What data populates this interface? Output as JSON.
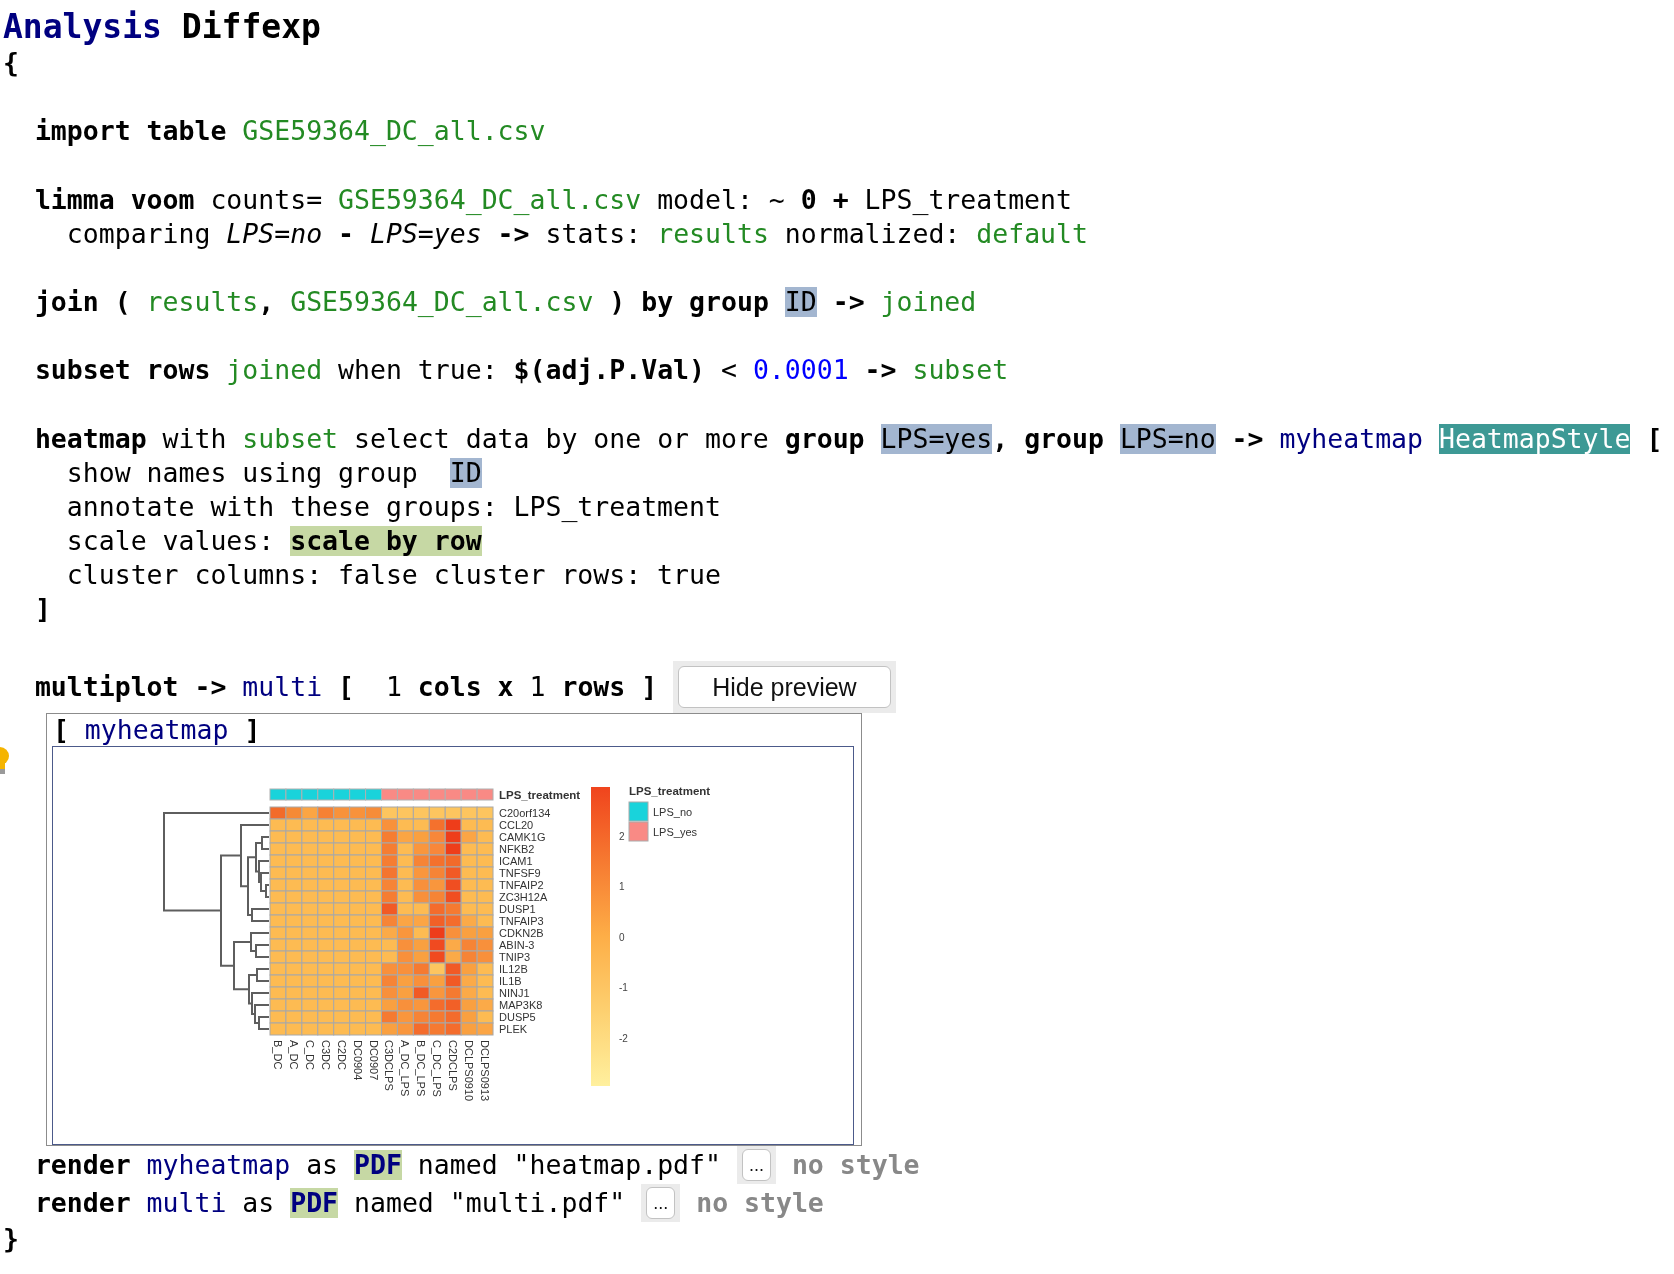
{
  "document": {
    "title": {
      "tokens": [
        {
          "kind": "concept",
          "text": "Analysis"
        },
        {
          "kind": "kw",
          "text": "Diffexp"
        }
      ]
    },
    "open": {
      "tokens": [
        {
          "kind": "kw",
          "text": "{"
        }
      ]
    },
    "statements": [
      {
        "lines": [
          {
            "kind": "code",
            "tokens": [
              {
                "kind": "kw",
                "text": "import table"
              },
              {
                "kind": "ref",
                "text": "GSE59364_DC_all.csv"
              }
            ]
          }
        ]
      },
      {
        "lines": [
          {
            "kind": "code",
            "tokens": [
              {
                "kind": "kw",
                "text": "limma voom"
              },
              {
                "kind": "txt",
                "text": "counts="
              },
              {
                "kind": "ref",
                "text": "GSE59364_DC_all.csv"
              },
              {
                "kind": "txt",
                "text": "model: ~"
              },
              {
                "kind": "kw",
                "text": "0 +"
              },
              {
                "kind": "txt",
                "text": "LPS_treatment"
              }
            ],
            "children": [
              {
                "kind": "code",
                "tokens": [
                  {
                    "kind": "txt",
                    "text": "comparing"
                  },
                  {
                    "kind": "it",
                    "text": "LPS=no"
                  },
                  {
                    "kind": "kw",
                    "text": "-"
                  },
                  {
                    "kind": "it",
                    "text": "LPS=yes"
                  },
                  {
                    "kind": "kw",
                    "text": "->"
                  },
                  {
                    "kind": "txt",
                    "text": "stats:"
                  },
                  {
                    "kind": "ref",
                    "text": "results"
                  },
                  {
                    "kind": "txt",
                    "text": "normalized:"
                  },
                  {
                    "kind": "ref",
                    "text": "default"
                  }
                ]
              }
            ]
          }
        ]
      },
      {
        "lines": [
          {
            "kind": "code",
            "tokens": [
              {
                "kind": "kw",
                "text": "join ("
              },
              {
                "kind": "ref",
                "text": "results"
              },
              {
                "kind": "punct",
                "text": ","
              },
              {
                "kind": "ref",
                "text": "GSE59364_DC_all.csv"
              },
              {
                "kind": "kw",
                "text": ") by group"
              },
              {
                "kind": "chip",
                "text": "ID"
              },
              {
                "kind": "kw",
                "text": "->"
              },
              {
                "kind": "ref",
                "text": "joined"
              }
            ]
          }
        ]
      },
      {
        "lines": [
          {
            "kind": "code",
            "tokens": [
              {
                "kind": "kw",
                "text": "subset rows"
              },
              {
                "kind": "ref",
                "text": "joined"
              },
              {
                "kind": "txt",
                "text": "when true:"
              },
              {
                "kind": "kw",
                "text": "$(adj.P.Val)"
              },
              {
                "kind": "txt",
                "text": "<"
              },
              {
                "kind": "num",
                "text": "0.0001"
              },
              {
                "kind": "kw",
                "text": "->"
              },
              {
                "kind": "ref",
                "text": "subset"
              }
            ]
          }
        ]
      },
      {
        "lines": [
          {
            "kind": "code",
            "tokens": [
              {
                "kind": "kw",
                "text": "heatmap"
              },
              {
                "kind": "txt",
                "text": "with"
              },
              {
                "kind": "ref",
                "text": "subset"
              },
              {
                "kind": "txt",
                "text": "select data by one or more"
              },
              {
                "kind": "kw",
                "text": "group"
              },
              {
                "kind": "chip",
                "text": "LPS=yes"
              },
              {
                "kind": "punct",
                "text": ","
              },
              {
                "kind": "kw",
                "text": "group"
              },
              {
                "kind": "chip",
                "text": "LPS=no"
              },
              {
                "kind": "kw",
                "text": "->"
              },
              {
                "kind": "id",
                "text": "myheatmap"
              },
              {
                "kind": "style",
                "text": "HeatmapStyle"
              },
              {
                "kind": "kw",
                "text": "["
              }
            ],
            "children": [
              {
                "kind": "code",
                "tokens": [
                  {
                    "kind": "txt",
                    "text": "show names using group"
                  },
                  {
                    "kind": "slotchip",
                    "text": "ID"
                  }
                ]
              },
              {
                "kind": "code",
                "tokens": [
                  {
                    "kind": "txt",
                    "text": "annotate with these groups: LPS_treatment"
                  }
                ]
              },
              {
                "kind": "code",
                "tokens": [
                  {
                    "kind": "txt",
                    "text": "scale values:"
                  },
                  {
                    "kind": "option",
                    "text": "scale by row"
                  }
                ]
              },
              {
                "kind": "code",
                "tokens": [
                  {
                    "kind": "txt",
                    "text": "cluster columns: false cluster rows: true"
                  }
                ]
              }
            ]
          },
          {
            "kind": "code",
            "tokens": [
              {
                "kind": "kw",
                "text": "]"
              }
            ]
          }
        ]
      },
      {
        "lines": [
          {
            "kind": "code",
            "tokens": [
              {
                "kind": "kw",
                "text": "multiplot ->"
              },
              {
                "kind": "id",
                "text": "multi"
              },
              {
                "kind": "kw",
                "text": "["
              },
              {
                "kind": "value",
                "text": "1"
              },
              {
                "kind": "kw",
                "text": "cols x"
              },
              {
                "kind": "txt",
                "text": "1"
              },
              {
                "kind": "kw",
                "text": "rows ]"
              },
              {
                "kind": "toggle",
                "text": "Hide preview"
              }
            ]
          },
          {
            "kind": "preview",
            "label": [
              {
                "kind": "kw",
                "text": "["
              },
              {
                "kind": "id",
                "text": "myheatmap"
              },
              {
                "kind": "kw",
                "text": "]"
              }
            ],
            "heatmap": {
              "annotation_label": "LPS_treatment",
              "columns": [
                {
                  "label": "B_DC",
                  "color": "#19d3db"
                },
                {
                  "label": "A_DC",
                  "color": "#19d3db"
                },
                {
                  "label": "C_DC",
                  "color": "#19d3db"
                },
                {
                  "label": "C3DC",
                  "color": "#19d3db"
                },
                {
                  "label": "C2DC",
                  "color": "#19d3db"
                },
                {
                  "label": "DC0904",
                  "color": "#19d3db"
                },
                {
                  "label": "DC0907",
                  "color": "#19d3db"
                },
                {
                  "label": "C3DCLPS",
                  "color": "#f98a85"
                },
                {
                  "label": "A_DC_LPS",
                  "color": "#f98a85"
                },
                {
                  "label": "B_DC_LPS",
                  "color": "#f98a85"
                },
                {
                  "label": "C_DC_LPS",
                  "color": "#f98a85"
                },
                {
                  "label": "C2DCLPS",
                  "color": "#f98a85"
                },
                {
                  "label": "DCLPS0910",
                  "color": "#f98a85"
                },
                {
                  "label": "DCLPS0913",
                  "color": "#f98a85"
                }
              ],
              "rows": [
                {
                  "label": "C20orf134",
                  "cells": [
                    {
                      "color": "#f26b2a"
                    },
                    {
                      "color": "#f58a36"
                    },
                    {
                      "color": "#fba544"
                    },
                    {
                      "color": "#f68134"
                    },
                    {
                      "color": "#f8923b"
                    },
                    {
                      "color": "#f8923b"
                    },
                    {
                      "color": "#f68c38"
                    },
                    {
                      "color": "#fdc55f"
                    },
                    {
                      "color": "#fdc55f"
                    },
                    {
                      "color": "#fdc55f"
                    },
                    {
                      "color": "#fdc55f"
                    },
                    {
                      "color": "#fdc55f"
                    },
                    {
                      "color": "#fdc55f"
                    },
                    {
                      "color": "#fdc55f"
                    }
                  ]
                },
                {
                  "label": "CCL20",
                  "cells": [
                    {
                      "color": "#fdbb52"
                    },
                    {
                      "color": "#fdbb52"
                    },
                    {
                      "color": "#fdbb52"
                    },
                    {
                      "color": "#fdbb52"
                    },
                    {
                      "color": "#fdbb52"
                    },
                    {
                      "color": "#fdbb52"
                    },
                    {
                      "color": "#fdbb52"
                    },
                    {
                      "color": "#f8913b"
                    },
                    {
                      "color": "#fdbb52"
                    },
                    {
                      "color": "#fdbb52"
                    },
                    {
                      "color": "#f4712d"
                    },
                    {
                      "color": "#ee3d1a"
                    },
                    {
                      "color": "#fdbb52"
                    },
                    {
                      "color": "#fdbb52"
                    }
                  ]
                },
                {
                  "label": "CAMK1G",
                  "cells": [
                    {
                      "color": "#fdbb52"
                    },
                    {
                      "color": "#fdbb52"
                    },
                    {
                      "color": "#fdbb52"
                    },
                    {
                      "color": "#fdbb52"
                    },
                    {
                      "color": "#fdbb52"
                    },
                    {
                      "color": "#fdbb52"
                    },
                    {
                      "color": "#fdbb52"
                    },
                    {
                      "color": "#f57d32"
                    },
                    {
                      "color": "#fba544"
                    },
                    {
                      "color": "#f9a040"
                    },
                    {
                      "color": "#f8873a"
                    },
                    {
                      "color": "#ee3d1a"
                    },
                    {
                      "color": "#fba545"
                    },
                    {
                      "color": "#fdbb52"
                    }
                  ]
                },
                {
                  "label": "NFKB2",
                  "cells": [
                    {
                      "color": "#fdbb52"
                    },
                    {
                      "color": "#fdbb52"
                    },
                    {
                      "color": "#fdbb52"
                    },
                    {
                      "color": "#fdbb52"
                    },
                    {
                      "color": "#fdbb52"
                    },
                    {
                      "color": "#fdbb52"
                    },
                    {
                      "color": "#fdbb52"
                    },
                    {
                      "color": "#f57d32"
                    },
                    {
                      "color": "#fdbb52"
                    },
                    {
                      "color": "#f9963d"
                    },
                    {
                      "color": "#f8873a"
                    },
                    {
                      "color": "#ee3d1a"
                    },
                    {
                      "color": "#fdbb52"
                    },
                    {
                      "color": "#fdbb52"
                    }
                  ]
                },
                {
                  "label": "ICAM1",
                  "cells": [
                    {
                      "color": "#fdbb52"
                    },
                    {
                      "color": "#fdbb52"
                    },
                    {
                      "color": "#fdbb52"
                    },
                    {
                      "color": "#fdbb52"
                    },
                    {
                      "color": "#fdbb52"
                    },
                    {
                      "color": "#fdbb52"
                    },
                    {
                      "color": "#fdbb52"
                    },
                    {
                      "color": "#f57d32"
                    },
                    {
                      "color": "#fdbb52"
                    },
                    {
                      "color": "#f68436"
                    },
                    {
                      "color": "#f4712d"
                    },
                    {
                      "color": "#f26a2a"
                    },
                    {
                      "color": "#fdbb52"
                    },
                    {
                      "color": "#fdbb52"
                    }
                  ]
                },
                {
                  "label": "TNFSF9",
                  "cells": [
                    {
                      "color": "#fdbb52"
                    },
                    {
                      "color": "#fdbb52"
                    },
                    {
                      "color": "#fdbb52"
                    },
                    {
                      "color": "#fdbb52"
                    },
                    {
                      "color": "#fdbb52"
                    },
                    {
                      "color": "#fdbb52"
                    },
                    {
                      "color": "#fdbb52"
                    },
                    {
                      "color": "#f47530"
                    },
                    {
                      "color": "#fdbb52"
                    },
                    {
                      "color": "#f9963d"
                    },
                    {
                      "color": "#f68436"
                    },
                    {
                      "color": "#f15a25"
                    },
                    {
                      "color": "#fdbb52"
                    },
                    {
                      "color": "#fdbb52"
                    }
                  ]
                },
                {
                  "label": "TNFAIP2",
                  "cells": [
                    {
                      "color": "#fdbb52"
                    },
                    {
                      "color": "#fdbb52"
                    },
                    {
                      "color": "#fdbb52"
                    },
                    {
                      "color": "#fdbb52"
                    },
                    {
                      "color": "#fdbb52"
                    },
                    {
                      "color": "#fdbb52"
                    },
                    {
                      "color": "#fdbb52"
                    },
                    {
                      "color": "#f68436"
                    },
                    {
                      "color": "#fdbb52"
                    },
                    {
                      "color": "#f8903b"
                    },
                    {
                      "color": "#f9963d"
                    },
                    {
                      "color": "#f04e21"
                    },
                    {
                      "color": "#fdbb52"
                    },
                    {
                      "color": "#fdbb52"
                    }
                  ]
                },
                {
                  "label": "ZC3H12A",
                  "cells": [
                    {
                      "color": "#fdbb52"
                    },
                    {
                      "color": "#fdbb52"
                    },
                    {
                      "color": "#fdbb52"
                    },
                    {
                      "color": "#fdbb52"
                    },
                    {
                      "color": "#fdbb52"
                    },
                    {
                      "color": "#fdbb52"
                    },
                    {
                      "color": "#fdbb52"
                    },
                    {
                      "color": "#f57d32"
                    },
                    {
                      "color": "#fdbb52"
                    },
                    {
                      "color": "#f8903b"
                    },
                    {
                      "color": "#f68436"
                    },
                    {
                      "color": "#f04e21"
                    },
                    {
                      "color": "#fdbb52"
                    },
                    {
                      "color": "#fdbb52"
                    }
                  ]
                },
                {
                  "label": "DUSP1",
                  "cells": [
                    {
                      "color": "#fdbb52"
                    },
                    {
                      "color": "#fdbb52"
                    },
                    {
                      "color": "#fdbb52"
                    },
                    {
                      "color": "#fdbb52"
                    },
                    {
                      "color": "#fdbb52"
                    },
                    {
                      "color": "#fdbb52"
                    },
                    {
                      "color": "#fdbb52"
                    },
                    {
                      "color": "#f15a25"
                    },
                    {
                      "color": "#fdbb52"
                    },
                    {
                      "color": "#fdbb52"
                    },
                    {
                      "color": "#f46c2c"
                    },
                    {
                      "color": "#f57a31"
                    },
                    {
                      "color": "#fdbb52"
                    },
                    {
                      "color": "#fdbb52"
                    }
                  ]
                },
                {
                  "label": "TNFAIP3",
                  "cells": [
                    {
                      "color": "#fdbb52"
                    },
                    {
                      "color": "#fdbb52"
                    },
                    {
                      "color": "#fdbb52"
                    },
                    {
                      "color": "#fdbb52"
                    },
                    {
                      "color": "#fdbb52"
                    },
                    {
                      "color": "#fdbb52"
                    },
                    {
                      "color": "#fdbb52"
                    },
                    {
                      "color": "#f68436"
                    },
                    {
                      "color": "#fba545"
                    },
                    {
                      "color": "#fba545"
                    },
                    {
                      "color": "#f26027"
                    },
                    {
                      "color": "#f46c2c"
                    },
                    {
                      "color": "#fbaa48"
                    },
                    {
                      "color": "#fdbb52"
                    }
                  ]
                },
                {
                  "label": "CDKN2B",
                  "cells": [
                    {
                      "color": "#fdbb52"
                    },
                    {
                      "color": "#fdbb52"
                    },
                    {
                      "color": "#fdbb52"
                    },
                    {
                      "color": "#fdbb52"
                    },
                    {
                      "color": "#fdbb52"
                    },
                    {
                      "color": "#fdbb52"
                    },
                    {
                      "color": "#fdbb52"
                    },
                    {
                      "color": "#fbaa48"
                    },
                    {
                      "color": "#f9963d"
                    },
                    {
                      "color": "#fdbb52"
                    },
                    {
                      "color": "#ee3d1a"
                    },
                    {
                      "color": "#f8903b"
                    },
                    {
                      "color": "#f9a040"
                    },
                    {
                      "color": "#f9a040"
                    }
                  ]
                },
                {
                  "label": "ABIN-3",
                  "cells": [
                    {
                      "color": "#fdbb52"
                    },
                    {
                      "color": "#fdbb52"
                    },
                    {
                      "color": "#fdbb52"
                    },
                    {
                      "color": "#fdbb52"
                    },
                    {
                      "color": "#fdbb52"
                    },
                    {
                      "color": "#fdbb52"
                    },
                    {
                      "color": "#fdbb52"
                    },
                    {
                      "color": "#fdbb52"
                    },
                    {
                      "color": "#f8903b"
                    },
                    {
                      "color": "#f9a040"
                    },
                    {
                      "color": "#f04a20"
                    },
                    {
                      "color": "#fbaa48"
                    },
                    {
                      "color": "#f68436"
                    },
                    {
                      "color": "#f8903b"
                    }
                  ]
                },
                {
                  "label": "TNIP3",
                  "cells": [
                    {
                      "color": "#fdbb52"
                    },
                    {
                      "color": "#fdbb52"
                    },
                    {
                      "color": "#fdbb52"
                    },
                    {
                      "color": "#fdbb52"
                    },
                    {
                      "color": "#fdbb52"
                    },
                    {
                      "color": "#fdbb52"
                    },
                    {
                      "color": "#fdbb52"
                    },
                    {
                      "color": "#fdbb52"
                    },
                    {
                      "color": "#f8903b"
                    },
                    {
                      "color": "#f9a040"
                    },
                    {
                      "color": "#f04a20"
                    },
                    {
                      "color": "#fbaa48"
                    },
                    {
                      "color": "#f68436"
                    },
                    {
                      "color": "#f8903b"
                    }
                  ]
                },
                {
                  "label": "IL12B",
                  "cells": [
                    {
                      "color": "#fdbb52"
                    },
                    {
                      "color": "#fdbb52"
                    },
                    {
                      "color": "#fdbb52"
                    },
                    {
                      "color": "#fdbb52"
                    },
                    {
                      "color": "#fdbb52"
                    },
                    {
                      "color": "#fdbb52"
                    },
                    {
                      "color": "#fdbb52"
                    },
                    {
                      "color": "#f8903b"
                    },
                    {
                      "color": "#f8903b"
                    },
                    {
                      "color": "#f57a31"
                    },
                    {
                      "color": "#fdc55f"
                    },
                    {
                      "color": "#f15a25"
                    },
                    {
                      "color": "#f9a040"
                    },
                    {
                      "color": "#fdbb52"
                    }
                  ]
                },
                {
                  "label": "IL1B",
                  "cells": [
                    {
                      "color": "#fdbb52"
                    },
                    {
                      "color": "#fdbb52"
                    },
                    {
                      "color": "#fdbb52"
                    },
                    {
                      "color": "#fdbb52"
                    },
                    {
                      "color": "#fdbb52"
                    },
                    {
                      "color": "#fdbb52"
                    },
                    {
                      "color": "#fdbb52"
                    },
                    {
                      "color": "#f68436"
                    },
                    {
                      "color": "#f9a040"
                    },
                    {
                      "color": "#f8903b"
                    },
                    {
                      "color": "#f9a040"
                    },
                    {
                      "color": "#f15a25"
                    },
                    {
                      "color": "#fbaa48"
                    },
                    {
                      "color": "#fdbb52"
                    }
                  ]
                },
                {
                  "label": "NINJ1",
                  "cells": [
                    {
                      "color": "#fdbb52"
                    },
                    {
                      "color": "#fdbb52"
                    },
                    {
                      "color": "#fdbb52"
                    },
                    {
                      "color": "#fdbb52"
                    },
                    {
                      "color": "#fdbb52"
                    },
                    {
                      "color": "#fdbb52"
                    },
                    {
                      "color": "#fdbb52"
                    },
                    {
                      "color": "#f8903b"
                    },
                    {
                      "color": "#f9a040"
                    },
                    {
                      "color": "#f15a25"
                    },
                    {
                      "color": "#f9963d"
                    },
                    {
                      "color": "#f57a31"
                    },
                    {
                      "color": "#fbaa48"
                    },
                    {
                      "color": "#fdbb52"
                    }
                  ]
                },
                {
                  "label": "MAP3K8",
                  "cells": [
                    {
                      "color": "#fdbb52"
                    },
                    {
                      "color": "#fdbb52"
                    },
                    {
                      "color": "#fdbb52"
                    },
                    {
                      "color": "#fdbb52"
                    },
                    {
                      "color": "#fdbb52"
                    },
                    {
                      "color": "#fdbb52"
                    },
                    {
                      "color": "#fdbb52"
                    },
                    {
                      "color": "#f9a040"
                    },
                    {
                      "color": "#f8903b"
                    },
                    {
                      "color": "#f9963d"
                    },
                    {
                      "color": "#f46c2c"
                    },
                    {
                      "color": "#f26027"
                    },
                    {
                      "color": "#f9a040"
                    },
                    {
                      "color": "#fbaa48"
                    }
                  ]
                },
                {
                  "label": "DUSP5",
                  "cells": [
                    {
                      "color": "#fdbb52"
                    },
                    {
                      "color": "#fdbb52"
                    },
                    {
                      "color": "#fdbb52"
                    },
                    {
                      "color": "#fdbb52"
                    },
                    {
                      "color": "#fdbb52"
                    },
                    {
                      "color": "#fdbb52"
                    },
                    {
                      "color": "#fdbb52"
                    },
                    {
                      "color": "#f57a31"
                    },
                    {
                      "color": "#f9963d"
                    },
                    {
                      "color": "#f68436"
                    },
                    {
                      "color": "#f57a31"
                    },
                    {
                      "color": "#f46c2c"
                    },
                    {
                      "color": "#f9a040"
                    },
                    {
                      "color": "#fdbb52"
                    }
                  ]
                },
                {
                  "label": "PLEK",
                  "cells": [
                    {
                      "color": "#fdbb52"
                    },
                    {
                      "color": "#fdbb52"
                    },
                    {
                      "color": "#fdbb52"
                    },
                    {
                      "color": "#fdbb52"
                    },
                    {
                      "color": "#fdbb52"
                    },
                    {
                      "color": "#fdbb52"
                    },
                    {
                      "color": "#fdbb52"
                    },
                    {
                      "color": "#f9a040"
                    },
                    {
                      "color": "#f9963d"
                    },
                    {
                      "color": "#f46c2c"
                    },
                    {
                      "color": "#f57a31"
                    },
                    {
                      "color": "#f46c2c"
                    },
                    {
                      "color": "#f9a040"
                    },
                    {
                      "color": "#fba545"
                    }
                  ]
                }
              ],
              "scale_ticks": [
                "2",
                "1",
                "0",
                "-1",
                "-2"
              ],
              "legend": {
                "title": "LPS_treatment",
                "items": [
                  {
                    "label": "LPS_no",
                    "color": "#19d3db"
                  },
                  {
                    "label": "LPS_yes",
                    "color": "#f98a85"
                  }
                ]
              }
            }
          },
          {
            "kind": "code",
            "tokens": [
              {
                "kind": "kw",
                "text": "render"
              },
              {
                "kind": "id",
                "text": "myheatmap"
              },
              {
                "kind": "txt",
                "text": "as"
              },
              {
                "kind": "format",
                "text": "PDF"
              },
              {
                "kind": "txt",
                "text": "named \"heatmap.pdf\""
              },
              {
                "kind": "more",
                "text": "..."
              },
              {
                "kind": "muted",
                "text": "no style"
              }
            ]
          },
          {
            "kind": "code",
            "tokens": [
              {
                "kind": "kw",
                "text": "render"
              },
              {
                "kind": "id",
                "text": "multi"
              },
              {
                "kind": "txt",
                "text": "as"
              },
              {
                "kind": "format",
                "text": "PDF"
              },
              {
                "kind": "txt",
                "text": "named \"multi.pdf\""
              },
              {
                "kind": "more",
                "text": "..."
              },
              {
                "kind": "muted",
                "text": "no style"
              }
            ]
          }
        ]
      }
    ],
    "close": {
      "tokens": [
        {
          "kind": "kw",
          "text": "}"
        }
      ]
    }
  }
}
